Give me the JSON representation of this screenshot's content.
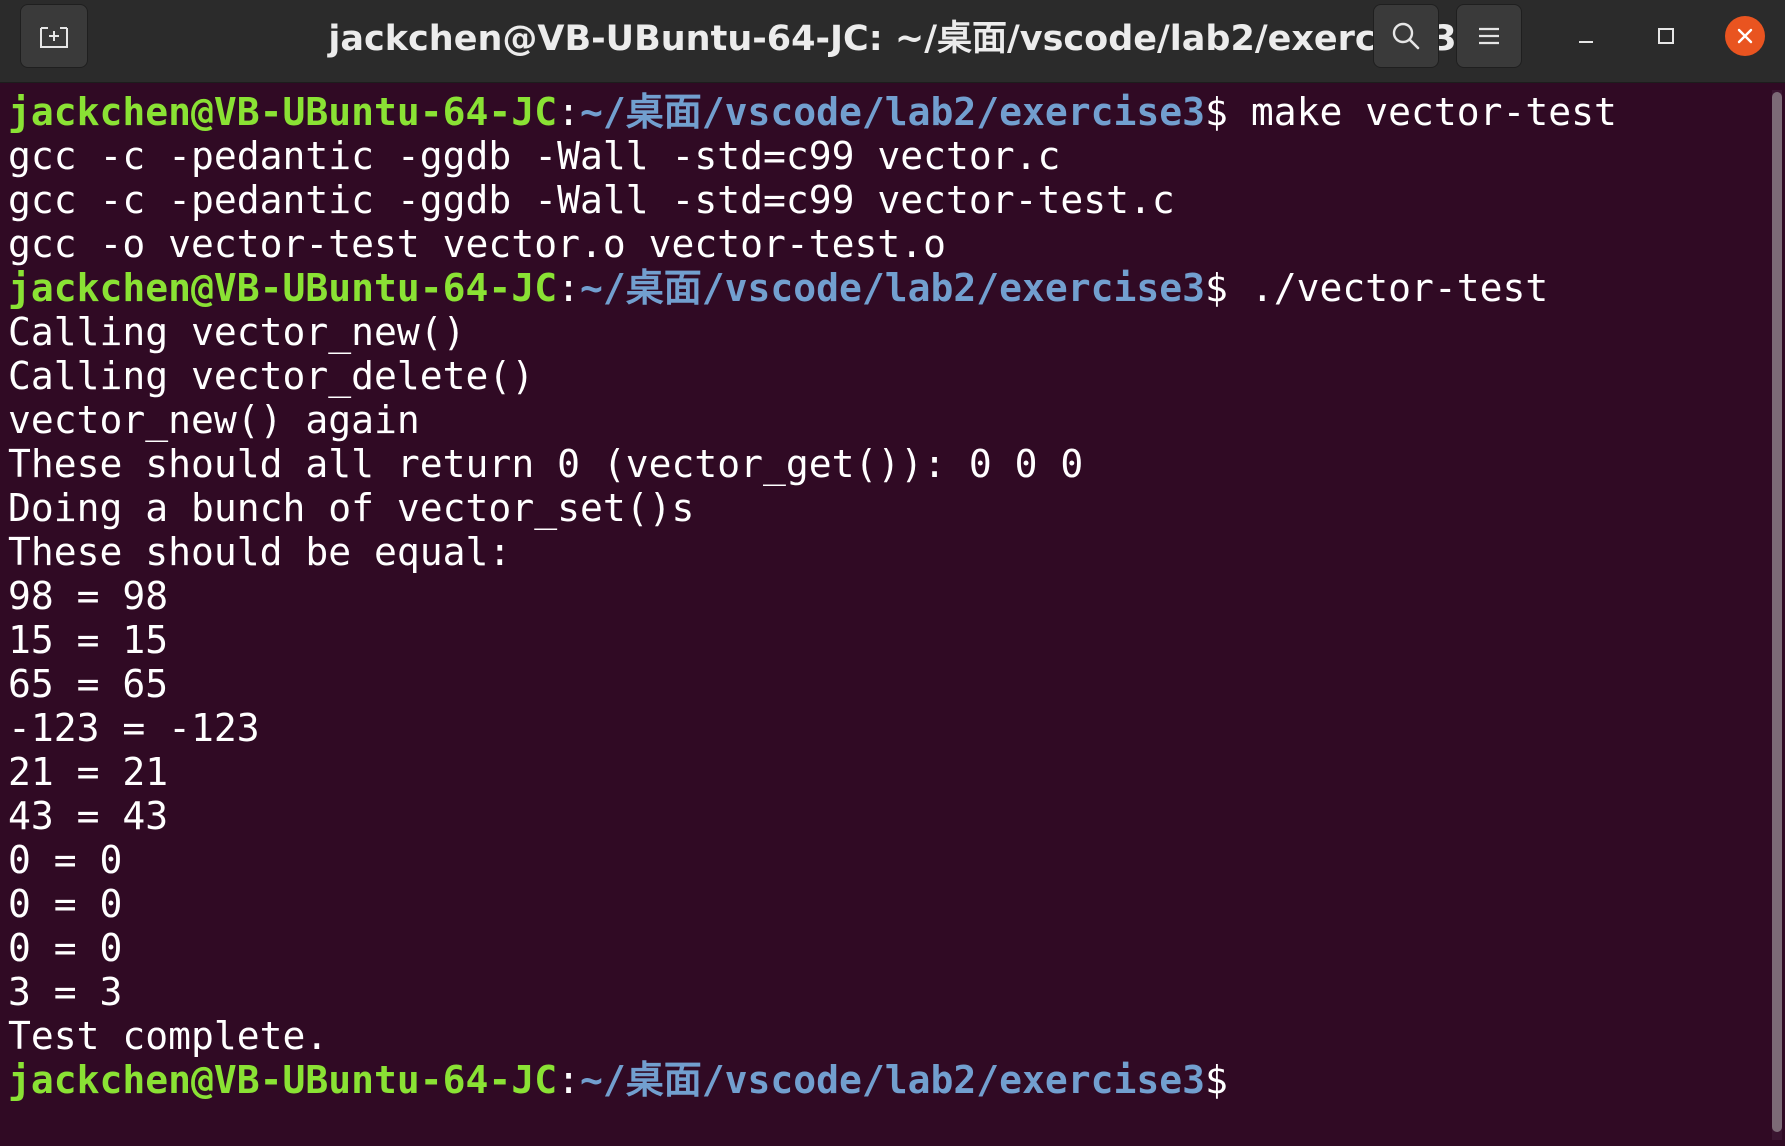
{
  "window": {
    "title": "jackchen@VB-UBuntu-64-JC: ~/桌面/vscode/lab2/exercise3"
  },
  "icons": {
    "new_tab": "new-tab-icon",
    "search": "search-icon",
    "menu": "hamburger-menu-icon",
    "minimize": "minimize-icon",
    "maximize": "maximize-icon",
    "close": "close-icon"
  },
  "colors": {
    "background": "#300a24",
    "prompt_user": "#8ae234",
    "prompt_path": "#729fcf",
    "text": "#ffffff",
    "close_button": "#e95420"
  },
  "prompt": {
    "user_host": "jackchen@VB-UBuntu-64-JC",
    "colon": ":",
    "path": "~/桌面/vscode/lab2/exercise3",
    "dollar": "$"
  },
  "terminal": {
    "lines": [
      {
        "type": "prompt",
        "command": " make vector-test"
      },
      {
        "type": "output",
        "text": "gcc -c -pedantic -ggdb -Wall -std=c99 vector.c"
      },
      {
        "type": "output",
        "text": "gcc -c -pedantic -ggdb -Wall -std=c99 vector-test.c"
      },
      {
        "type": "output",
        "text": "gcc -o vector-test vector.o vector-test.o"
      },
      {
        "type": "prompt",
        "command": " ./vector-test"
      },
      {
        "type": "output",
        "text": "Calling vector_new()"
      },
      {
        "type": "output",
        "text": "Calling vector_delete()"
      },
      {
        "type": "output",
        "text": "vector_new() again"
      },
      {
        "type": "output",
        "text": "These should all return 0 (vector_get()): 0 0 0"
      },
      {
        "type": "output",
        "text": "Doing a bunch of vector_set()s"
      },
      {
        "type": "output",
        "text": "These should be equal:"
      },
      {
        "type": "output",
        "text": "98 = 98"
      },
      {
        "type": "output",
        "text": "15 = 15"
      },
      {
        "type": "output",
        "text": "65 = 65"
      },
      {
        "type": "output",
        "text": "-123 = -123"
      },
      {
        "type": "output",
        "text": "21 = 21"
      },
      {
        "type": "output",
        "text": "43 = 43"
      },
      {
        "type": "output",
        "text": "0 = 0"
      },
      {
        "type": "output",
        "text": "0 = 0"
      },
      {
        "type": "output",
        "text": "0 = 0"
      },
      {
        "type": "output",
        "text": "3 = 3"
      },
      {
        "type": "output",
        "text": "Test complete."
      },
      {
        "type": "prompt",
        "command": ""
      }
    ]
  }
}
